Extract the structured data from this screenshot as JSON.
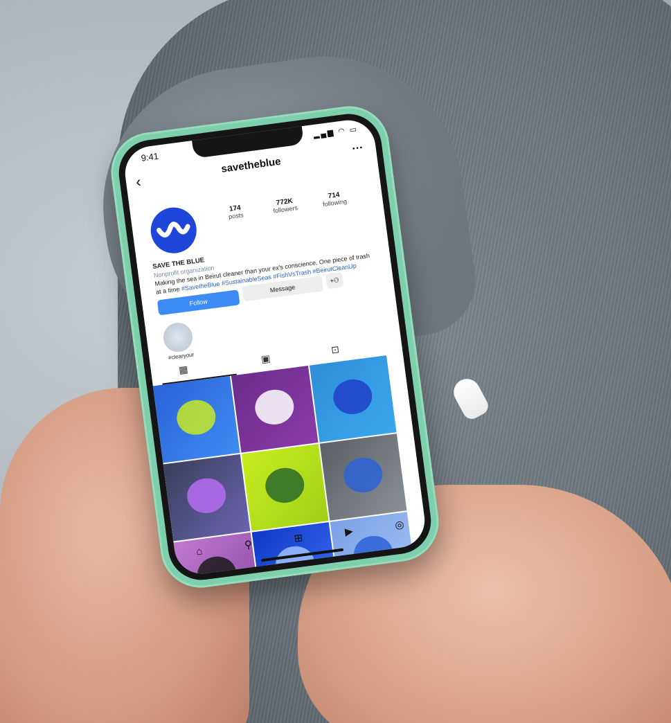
{
  "status_bar": {
    "time": "9:41",
    "signal_icons": "signal-wifi-battery"
  },
  "profile": {
    "username": "savetheblue",
    "display_name": "SAVE THE BLUE",
    "category": "Nonprofit organization",
    "bio_text": "Making the sea in Beirut cleaner than your ex's conscience. One piece of trash at a time",
    "bio_tags": "#SavetheBlue #SustainableSeas #FishVsTrash #BeirutCleanUp",
    "stats": [
      {
        "value": "174",
        "label": "posts"
      },
      {
        "value": "772K",
        "label": "followers"
      },
      {
        "value": "714",
        "label": "following"
      }
    ],
    "avatar_color": "#1e46d8"
  },
  "actions": {
    "follow_label": "Follow",
    "message_label": "Message"
  },
  "highlights": [
    {
      "label": "#clearyour"
    }
  ],
  "tabs": {
    "grid_icon": "grid-icon",
    "reels_icon": "reels-icon",
    "tagged_icon": "tagged-icon"
  },
  "posts": [
    {
      "bg": "linear-gradient(135deg,#2a63d8,#3f8bf0)",
      "accent": "#c6e928"
    },
    {
      "bg": "linear-gradient(135deg,#6b2c8a,#8a3ca9)",
      "accent": "#ffffff"
    },
    {
      "bg": "linear-gradient(135deg,#2f8fd8,#3aa7ef)",
      "accent": "#1f3fc9"
    },
    {
      "bg": "linear-gradient(135deg,#3a3f5a,#6a63b0)",
      "accent": "#b56cf0"
    },
    {
      "bg": "linear-gradient(135deg,#c8ec1e,#9fd11a)",
      "accent": "#2c6b2a"
    },
    {
      "bg": "linear-gradient(135deg,#5a5f66,#8a9096)",
      "accent": "#2d63d8"
    },
    {
      "bg": "linear-gradient(135deg,#c07ad0,#8a4aa6)",
      "accent": "#1a1a1a"
    },
    {
      "bg": "linear-gradient(135deg,#1038c8,#3a6ff0)",
      "accent": "#9fc0ff"
    },
    {
      "bg": "linear-gradient(135deg,#7aa0e6,#a5c2f2)",
      "accent": "#2d63d8"
    }
  ],
  "bottom_nav": [
    {
      "name": "home-icon",
      "glyph": "⌂"
    },
    {
      "name": "search-icon",
      "glyph": "⚲"
    },
    {
      "name": "create-icon",
      "glyph": "⊞"
    },
    {
      "name": "reels-nav-icon",
      "glyph": "▶"
    },
    {
      "name": "profile-icon",
      "glyph": "◎"
    }
  ],
  "colors": {
    "case": "#7dcfae",
    "follow_button": "#3d8bf5",
    "hashtag": "#2f5fc4"
  }
}
